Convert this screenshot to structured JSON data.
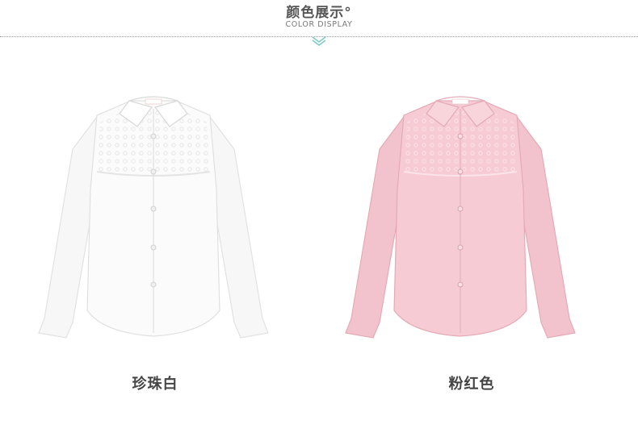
{
  "header": {
    "title": "颜色展示°",
    "subtitle": "COLOR DISPLAY",
    "divider_icon": "double-chevron-down-icon",
    "accent_color": "#7fc9c4"
  },
  "products": [
    {
      "color_name": "珍珠白",
      "shirt_color": "#fbfbfb",
      "image": "white-shirt-image"
    },
    {
      "color_name": "粉红色",
      "shirt_color": "#f6cbd3",
      "image": "pink-shirt-image"
    }
  ]
}
